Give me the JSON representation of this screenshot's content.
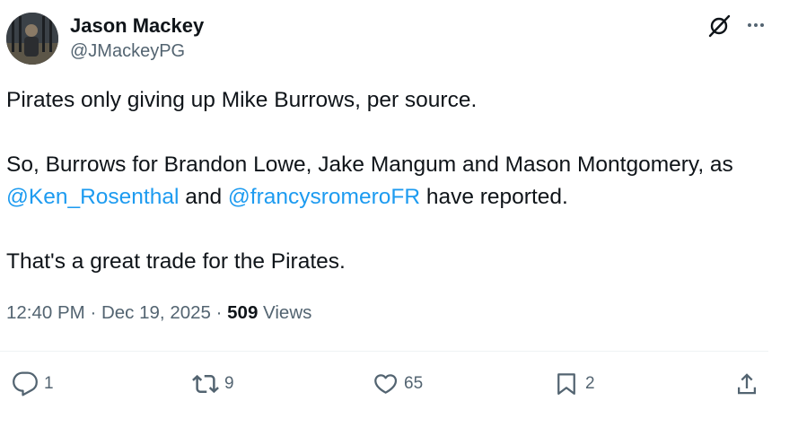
{
  "author": {
    "name": "Jason Mackey",
    "handle": "@JMackeyPG"
  },
  "tweet": {
    "line1": "Pirates only giving up Mike Burrows, per source.",
    "line2_prefix": "So, Burrows for Brandon Lowe, Jake Mangum and Mason Montgomery, as ",
    "mention1": "@Ken_Rosenthal",
    "line2_and": " and ",
    "mention2": "@francysromeroFR",
    "line2_suffix": " have reported.",
    "line3": "That's a great trade for the Pirates."
  },
  "meta": {
    "time": "12:40 PM",
    "separator": " · ",
    "date": "Dec 19, 2025",
    "views_count": "509",
    "views_label": " Views"
  },
  "actions": {
    "replies": "1",
    "reposts": "9",
    "likes": "65",
    "bookmarks": "2"
  },
  "icons": [
    "avatar",
    "grok-icon",
    "more-icon",
    "reply-icon",
    "repost-icon",
    "like-icon",
    "bookmark-icon",
    "share-icon"
  ],
  "colors": {
    "text": "#0f1419",
    "secondary": "#536471",
    "link": "#1d9bf0",
    "divider": "#eff3f4"
  }
}
